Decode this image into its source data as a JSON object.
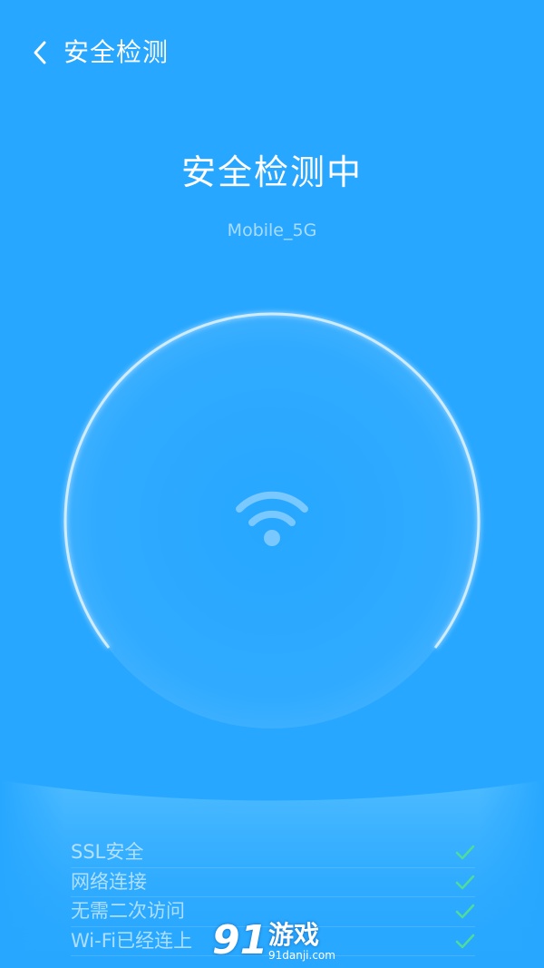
{
  "header": {
    "title": "安全检测"
  },
  "status": {
    "title": "安全检测中",
    "network_name": "Mobile_5G"
  },
  "checks": [
    {
      "label": "SSL安全",
      "done": true
    },
    {
      "label": "网络连接",
      "done": true
    },
    {
      "label": "无需二次访问",
      "done": true
    },
    {
      "label": "Wi-Fi已经连上",
      "done": true
    }
  ],
  "watermark": {
    "logo_number": "91",
    "logo_text": "游戏",
    "url": "91danji.com"
  },
  "colors": {
    "background": "#27a7ff",
    "check_green": "#4fdc9a"
  },
  "icons": {
    "back": "chevron-left-icon",
    "wifi": "wifi-icon",
    "check": "check-icon"
  }
}
